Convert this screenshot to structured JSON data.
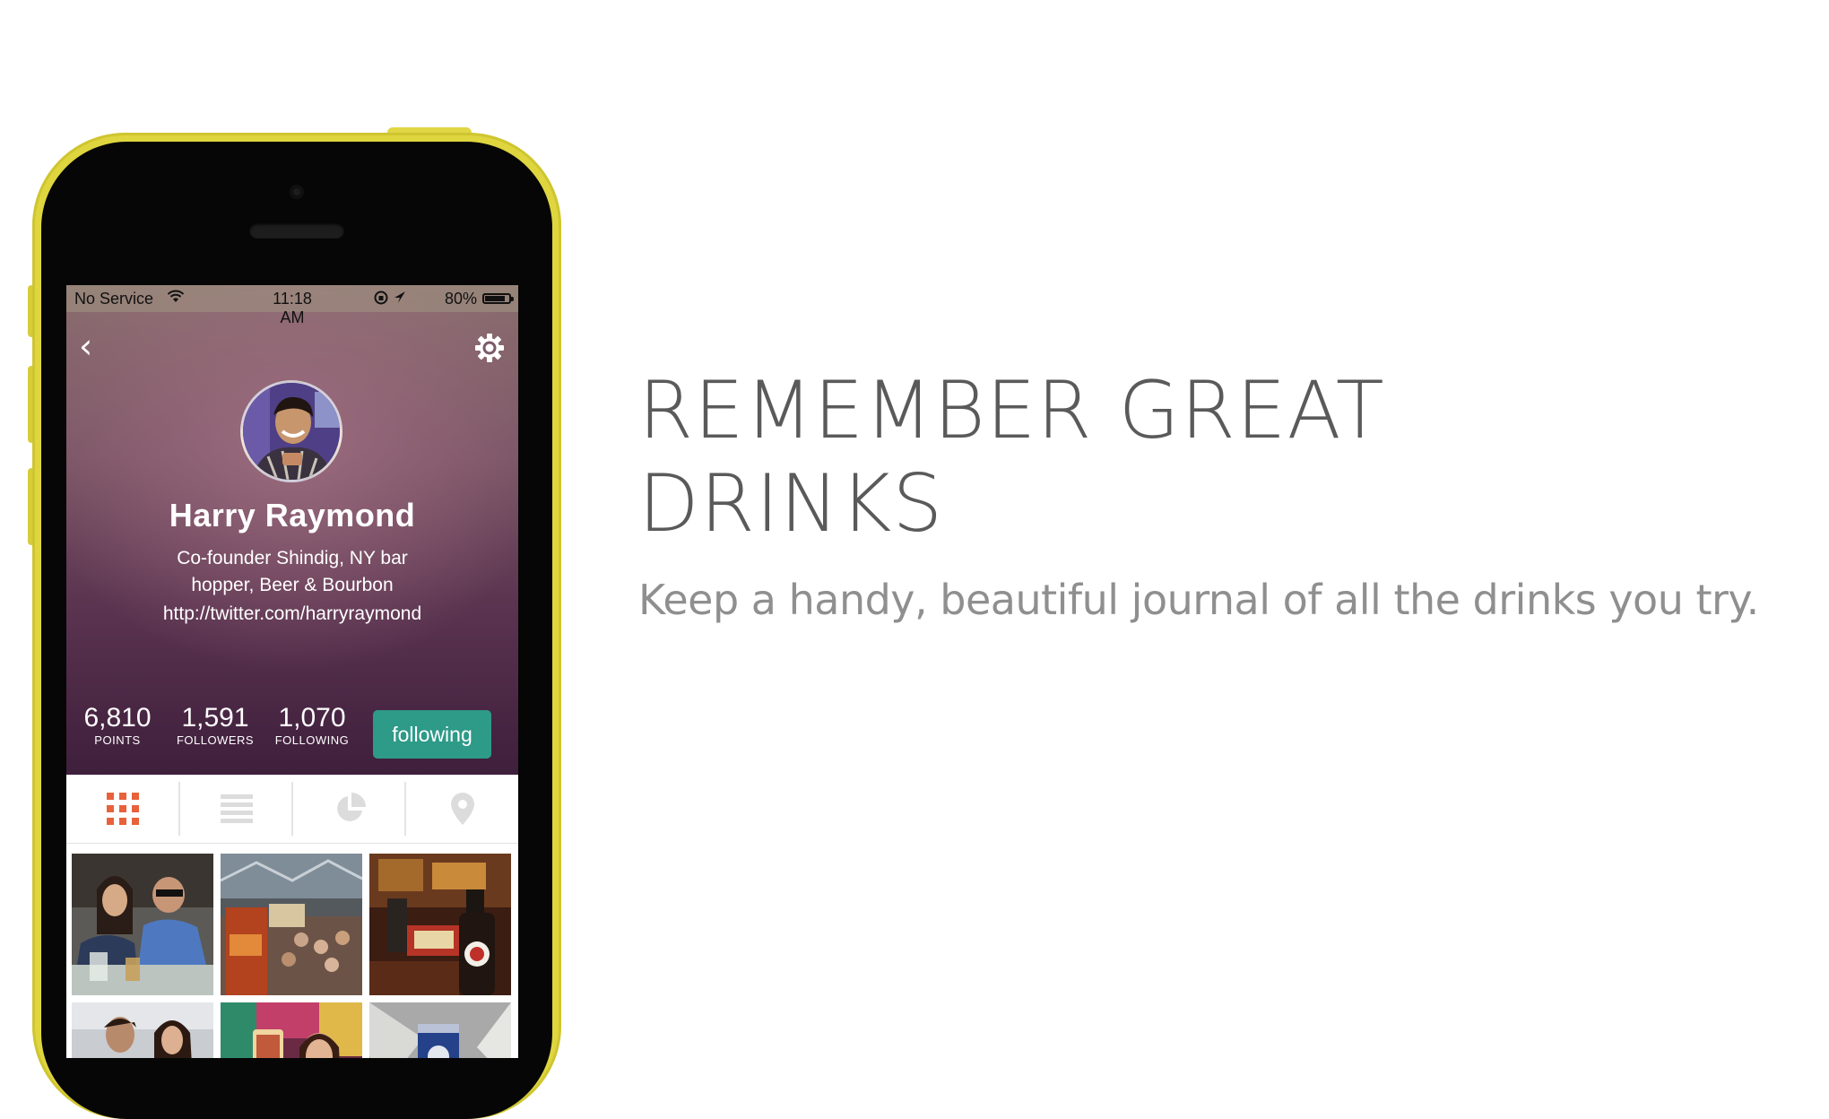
{
  "statusbar": {
    "carrier": "No Service",
    "time": "11:18 AM",
    "battery": "80%"
  },
  "profile": {
    "name": "Harry Raymond",
    "bio": "Co-founder Shindig, NY bar hopper, Beer & Bourbon",
    "link": "http://twitter.com/harryraymond"
  },
  "stats": [
    {
      "value": "6,810",
      "label": "POINTS"
    },
    {
      "value": "1,591",
      "label": "FOLLOWERS"
    },
    {
      "value": "1,070",
      "label": "FOLLOWING"
    }
  ],
  "follow_button": {
    "label": "following",
    "color": "#2e9a88"
  },
  "tabs": [
    {
      "icon": "grid-icon",
      "active": true
    },
    {
      "icon": "list-icon",
      "active": false
    },
    {
      "icon": "pie-chart-icon",
      "active": false
    },
    {
      "icon": "map-pin-icon",
      "active": false
    }
  ],
  "accent_color": "#e8613a",
  "phone_color": "#dfd63f",
  "headline": {
    "line1": "REMEMBER GREAT",
    "line2": "DRINKS",
    "subtitle": "Keep a handy, beautiful journal of all the drinks you try."
  }
}
